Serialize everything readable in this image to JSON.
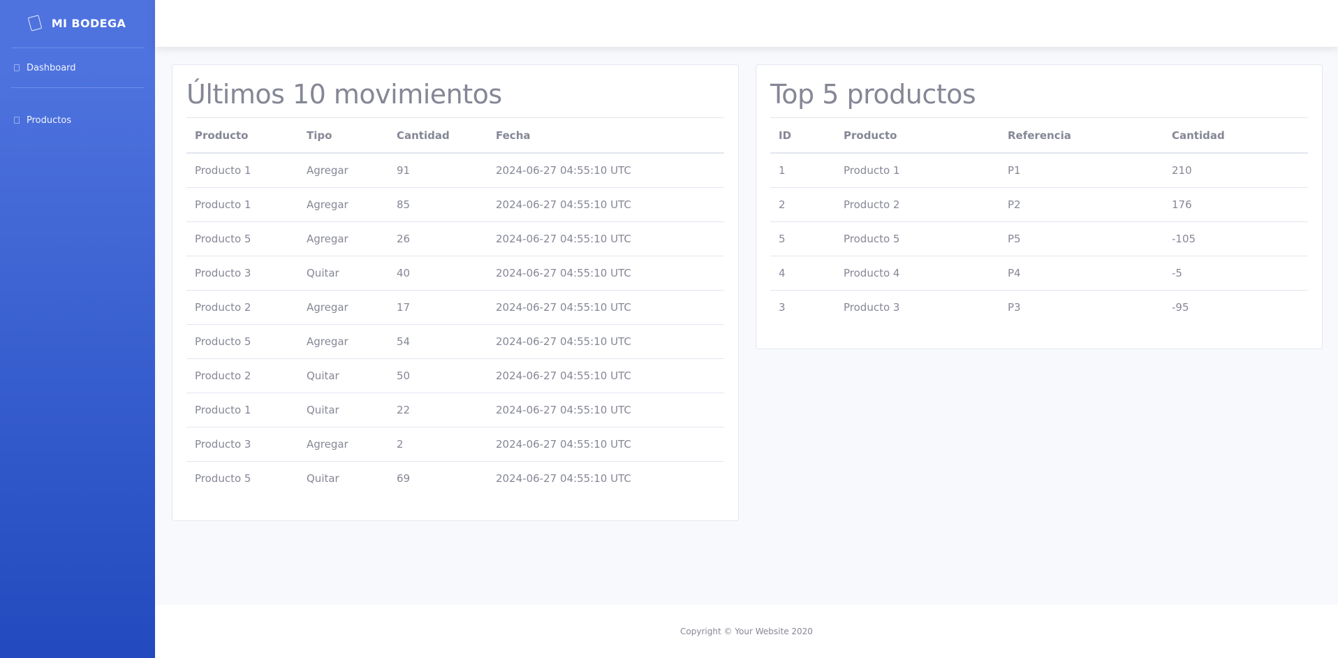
{
  "sidebar": {
    "brand": "MI BODEGA",
    "items": [
      {
        "label": "Dashboard"
      },
      {
        "label": "Productos"
      }
    ]
  },
  "movements": {
    "title": "Últimos 10 movimientos",
    "headers": [
      "Producto",
      "Tipo",
      "Cantidad",
      "Fecha"
    ],
    "rows": [
      [
        "Producto 1",
        "Agregar",
        "91",
        "2024-06-27 04:55:10 UTC"
      ],
      [
        "Producto 1",
        "Agregar",
        "85",
        "2024-06-27 04:55:10 UTC"
      ],
      [
        "Producto 5",
        "Agregar",
        "26",
        "2024-06-27 04:55:10 UTC"
      ],
      [
        "Producto 3",
        "Quitar",
        "40",
        "2024-06-27 04:55:10 UTC"
      ],
      [
        "Producto 2",
        "Agregar",
        "17",
        "2024-06-27 04:55:10 UTC"
      ],
      [
        "Producto 5",
        "Agregar",
        "54",
        "2024-06-27 04:55:10 UTC"
      ],
      [
        "Producto 2",
        "Quitar",
        "50",
        "2024-06-27 04:55:10 UTC"
      ],
      [
        "Producto 1",
        "Quitar",
        "22",
        "2024-06-27 04:55:10 UTC"
      ],
      [
        "Producto 3",
        "Agregar",
        "2",
        "2024-06-27 04:55:10 UTC"
      ],
      [
        "Producto 5",
        "Quitar",
        "69",
        "2024-06-27 04:55:10 UTC"
      ]
    ]
  },
  "top_products": {
    "title": "Top 5 productos",
    "headers": [
      "ID",
      "Producto",
      "Referencia",
      "Cantidad"
    ],
    "rows": [
      [
        "1",
        "Producto 1",
        "P1",
        "210"
      ],
      [
        "2",
        "Producto 2",
        "P2",
        "176"
      ],
      [
        "5",
        "Producto 5",
        "P5",
        "-105"
      ],
      [
        "4",
        "Producto 4",
        "P4",
        "-5"
      ],
      [
        "3",
        "Producto 3",
        "P3",
        "-95"
      ]
    ]
  },
  "footer": {
    "copyright": "Copyright © Your Website 2020"
  }
}
